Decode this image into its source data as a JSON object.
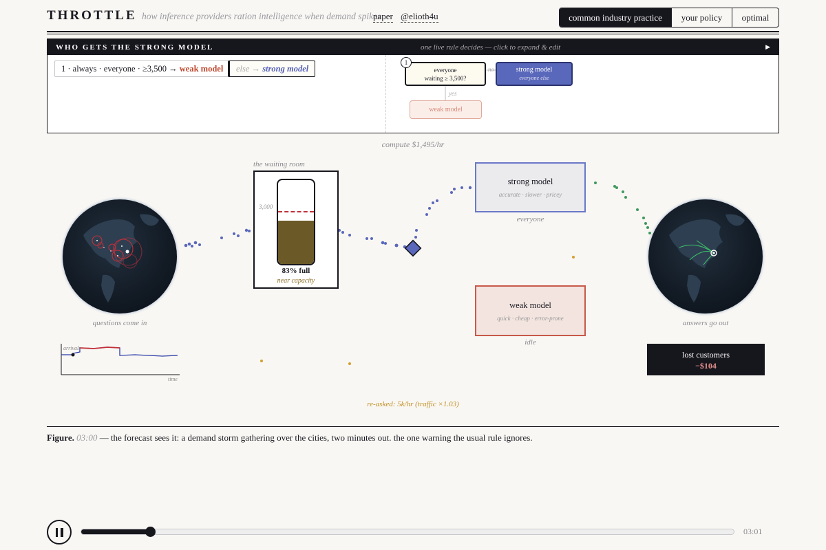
{
  "header": {
    "brand": "THROTTLE",
    "tagline": "how inference providers ration intelligence when demand spikes",
    "links": [
      "paper",
      "@elioth4u"
    ],
    "tabs": [
      {
        "label": "common industry practice",
        "active": true
      },
      {
        "label": "your policy",
        "active": false
      },
      {
        "label": "optimal",
        "active": false
      }
    ]
  },
  "rules_panel": {
    "title": "WHO GETS THE STRONG MODEL",
    "subtitle": "one live rule decides — click to expand & edit",
    "expand_icon": "triangle-right-icon",
    "rule1": {
      "prefix": "1 · always · everyone · ≥3,500 →",
      "target": "weak model"
    },
    "rule_else": {
      "prefix": "else →",
      "target": "strong model"
    },
    "tree": {
      "step_number": "1",
      "condition_line1": "everyone",
      "condition_line2": "waiting ≥ 3,500?",
      "no_label": "no",
      "yes_label": "yes",
      "no_target": "strong model",
      "no_target_sub": "everyone else",
      "yes_target": "weak model"
    }
  },
  "sim": {
    "compute": "compute $1,495/hr",
    "waiting_room": {
      "label": "the waiting room",
      "threshold": "3,000",
      "fill_fraction": 0.83,
      "fill_text": "83% full",
      "status": "near capacity"
    },
    "strong_model": {
      "title": "strong model",
      "sub": "accurate · slower · pricey",
      "caption": "everyone"
    },
    "weak_model": {
      "title": "weak model",
      "sub": "quick · cheap · error-prone",
      "caption": "idle"
    },
    "globe_left_caption": "questions come in",
    "globe_right_caption": "answers go out",
    "arrivals": {
      "label": "arrivals",
      "axis": "time"
    },
    "lost": {
      "label": "lost customers",
      "value": "−$104"
    },
    "reasked": "re-asked: 5k/hr (traffic ×1.03)"
  },
  "figure": {
    "label": "Figure.",
    "time": "03:00",
    "text": "— the forecast sees it: a demand storm gathering over the cities, two minutes out. the one warning the usual rule ignores."
  },
  "player": {
    "pause_icon": "pause-icon",
    "progress": 0.106,
    "time": "03:01"
  },
  "colors": {
    "ink": "#16161d",
    "strong": "#5a68bb",
    "weak": "#c0482e",
    "queue_fill": "#6b5a27",
    "answers": "#3e9a5e",
    "retry": "#d4a030"
  }
}
